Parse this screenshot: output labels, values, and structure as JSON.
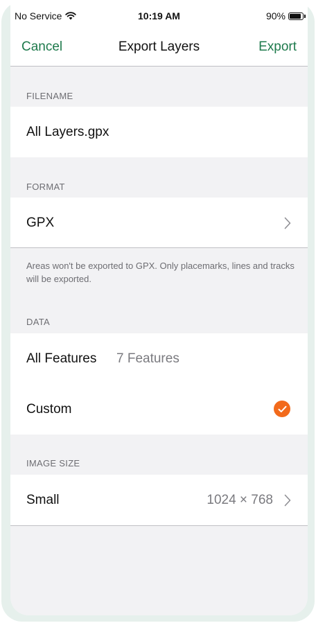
{
  "status_bar": {
    "carrier": "No Service",
    "time": "10:19 AM",
    "battery_text": "90%",
    "battery_level": 0.9
  },
  "nav": {
    "cancel_label": "Cancel",
    "title": "Export Layers",
    "export_label": "Export"
  },
  "sections": {
    "filename": {
      "header": "FILENAME",
      "value": "All Layers.gpx"
    },
    "format": {
      "header": "FORMAT",
      "value": "GPX",
      "footer": "Areas won't be exported to GPX. Only placemarks, lines and tracks will be exported."
    },
    "data": {
      "header": "DATA",
      "all_features_label": "All Features",
      "all_features_count": "7 Features",
      "custom_label": "Custom",
      "custom_selected": true
    },
    "image_size": {
      "header": "IMAGE SIZE",
      "label": "Small",
      "value": "1024 × 768"
    }
  },
  "colors": {
    "accent": "#1e7a4c",
    "check": "#f26a1b",
    "background": "#f2f2f4"
  },
  "icons": [
    "wifi-icon",
    "battery-icon",
    "chevron-right-icon",
    "checkmark-icon"
  ]
}
